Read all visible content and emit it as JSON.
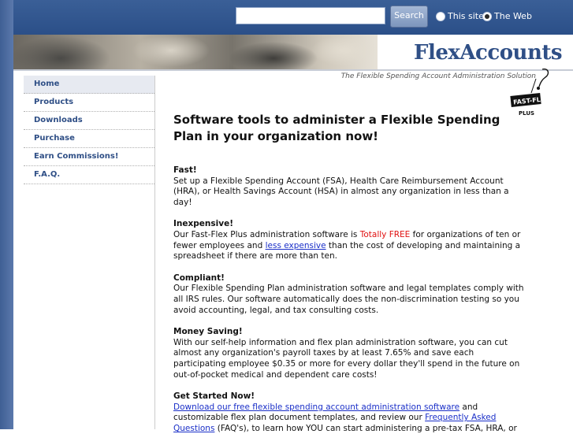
{
  "search": {
    "placeholder": "",
    "button_label": "Search",
    "options": [
      {
        "label": "This site",
        "checked": false
      },
      {
        "label": "The Web",
        "checked": true
      }
    ]
  },
  "brand": {
    "name": "FlexAccounts",
    "tagline": "The Flexible Spending Account Administration Solution",
    "logo_text_top": "FAST-FLEX",
    "logo_text_bottom": "PLUS"
  },
  "sidebar": {
    "items": [
      {
        "label": "Home",
        "active": true
      },
      {
        "label": "Products",
        "active": false
      },
      {
        "label": "Downloads",
        "active": false
      },
      {
        "label": "Purchase",
        "active": false
      },
      {
        "label": "Earn Commissions!",
        "active": false
      },
      {
        "label": "F.A.Q.",
        "active": false
      }
    ]
  },
  "main": {
    "headline": "Software tools to administer a Flexible Spending Plan in your organization now!",
    "sections": [
      {
        "title": "Fast!",
        "body": "Set up a Flexible Spending Account (FSA), Health Care Reimbursement Account (HRA), or Health Savings Account (HSA) in almost any organization in less than a day!"
      },
      {
        "title": "Inexpensive!",
        "body_1": "Our Fast-Flex Plus administration software is ",
        "highlight": "Totally FREE",
        "body_2": " for organizations of ten or fewer employees and ",
        "link": "less expensive",
        "body_3": " than the cost of developing and maintaining a spreadsheet if there are more than ten."
      },
      {
        "title": "Compliant!",
        "body": "Our Flexible Spending Plan administration software and legal templates comply with all IRS rules. Our software automatically does the non-discrimination testing so you avoid accounting, legal, and tax consulting costs."
      },
      {
        "title": "Money Saving!",
        "body": "With our self-help information and flex plan administration software, you can cut almost any organization's payroll taxes by at least 7.65% and save each participating employee $0.35 or more for every dollar they'll spend in the future on out-of-pocket medical and dependent care costs!"
      },
      {
        "title": "Get Started Now!",
        "link_1": "Download our free flexible spending account administration software",
        "body_1": " and customizable flex plan document templates, and review our ",
        "link_2": "Frequently Asked Questions",
        "body_2": " (FAQ's), to learn how YOU can start administering a pre-tax FSA, HRA, or"
      }
    ]
  },
  "colors": {
    "top_bar": "#2b4f88",
    "brand": "#2f4f86",
    "highlight": "#e01010",
    "link": "#1a2fc8"
  }
}
